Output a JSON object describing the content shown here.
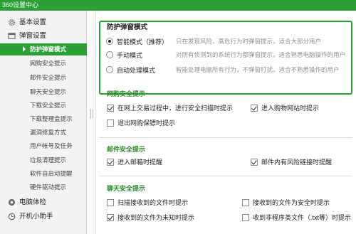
{
  "window": {
    "title": "360设置中心"
  },
  "sidebar": {
    "groups": [
      {
        "label": "基本设置",
        "icon": "gear-icon"
      },
      {
        "label": "弹窗设置",
        "icon": "window-icon"
      },
      {
        "label": "电脑体检",
        "icon": "checkup-icon"
      },
      {
        "label": "开机小助手",
        "icon": "clock-icon"
      }
    ],
    "items": [
      {
        "label": "防护弹窗模式",
        "active": true
      },
      {
        "label": "网购安全提示"
      },
      {
        "label": "邮件安全提示"
      },
      {
        "label": "聊天安全提示"
      },
      {
        "label": "下载安全提示"
      },
      {
        "label": "下载整理盒提示"
      },
      {
        "label": "漏洞修复方式"
      },
      {
        "label": "用户帐号及任务"
      },
      {
        "label": "垃圾清理提示"
      },
      {
        "label": "软件自启动提醒"
      },
      {
        "label": "硬件驱动提示"
      }
    ]
  },
  "protect_mode": {
    "title": "防护弹窗模式",
    "options": [
      {
        "label": "智能模式（推荐）",
        "desc": "只在发现风险、高危行为时弹窗提示，适合大部分用户",
        "selected": true
      },
      {
        "label": "手动模式",
        "desc": "对所有侦测到的系统行为都弹窗提示，适合熟悉电脑操作的用户",
        "selected": false
      },
      {
        "label": "自动处理模式",
        "desc": "智能处理电脑所有行为，不弹窗打扰，适合不熟悉操作的用户",
        "selected": false
      }
    ]
  },
  "shopping": {
    "title": "网购安全提示",
    "options": [
      {
        "label": "在网上交易过程中，进行安全扫描时提示",
        "checked": true
      },
      {
        "label": "进入购物网站时提示",
        "checked": true
      },
      {
        "label": "退出网购保镖时提示",
        "checked": false
      }
    ]
  },
  "mail": {
    "title": "邮件安全提示",
    "options": [
      {
        "label": "进入邮箱时提醒",
        "checked": true
      },
      {
        "label": "邮件内有风险链接时提醒",
        "checked": true
      }
    ]
  },
  "chat": {
    "title": "聊天安全提示",
    "options": [
      {
        "label": "扫描接收到的文件时提示",
        "checked": false
      },
      {
        "label": "接收到的文件为安全时提示",
        "checked": false
      },
      {
        "label": "接收到的文件为未知时提示",
        "checked": true
      },
      {
        "label": "收到非程序类文件（.txt等）时提示",
        "checked": false
      }
    ]
  }
}
